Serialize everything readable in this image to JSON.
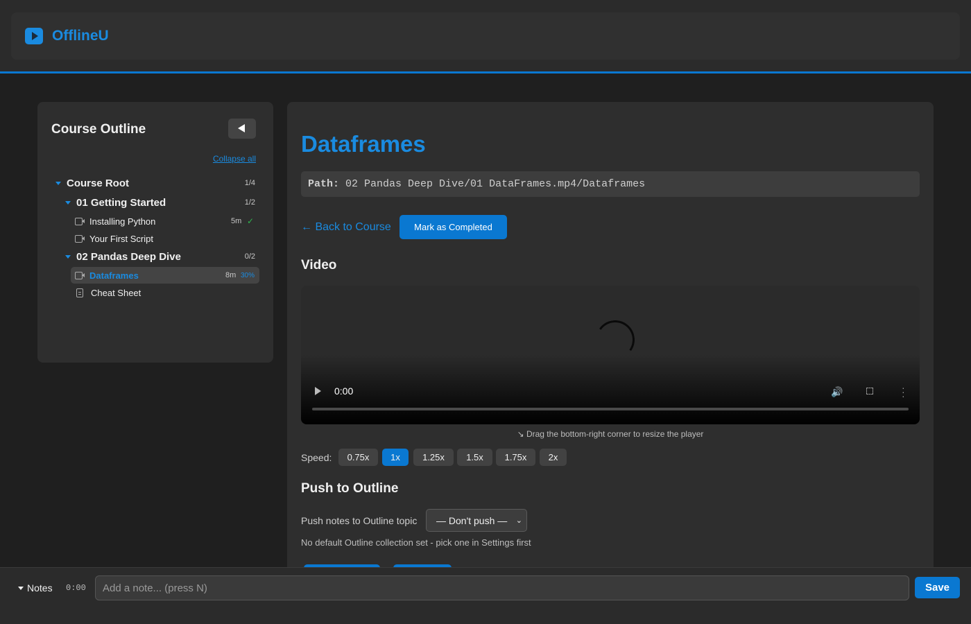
{
  "app": {
    "name": "OfflineU",
    "accent": "#0a78d1",
    "icon": "play-icon"
  },
  "sidebar": {
    "title": "Course Outline",
    "collapse_all": "Collapse all",
    "root": {
      "label": "Course Root",
      "count": "1/4"
    },
    "sections": [
      {
        "label": "01 Getting Started",
        "count": "1/2",
        "items": [
          {
            "label": "Installing Python",
            "duration": "5m",
            "completed": true,
            "type": "video"
          },
          {
            "label": "Your First Script",
            "type": "video"
          }
        ]
      },
      {
        "label": "02 Pandas Deep Dive",
        "count": "0/2",
        "items": [
          {
            "label": "Dataframes",
            "duration": "8m",
            "progress": "30%",
            "active": true,
            "type": "video"
          },
          {
            "label": "Cheat Sheet",
            "type": "document"
          }
        ]
      }
    ]
  },
  "main": {
    "title": "Dataframes",
    "path_label": "Path:",
    "path_value": "02 Pandas Deep Dive/01 DataFrames.mp4/Dataframes",
    "back_label": "← Back to Course",
    "mark_label": "Mark as Completed",
    "video_heading": "Video",
    "video_time": "0:00",
    "resize_hint": "↘ Drag the bottom-right corner to resize the player",
    "speed_label": "Speed:",
    "speeds": [
      "0.75x",
      "1x",
      "1.25x",
      "1.5x",
      "1.75x",
      "2x"
    ],
    "active_speed": "1x",
    "push_heading": "Push to Outline",
    "push_label": "Push notes to Outline topic",
    "push_select": "— Don't push —",
    "push_note": "No default Outline collection set - pick one in Settings first"
  },
  "notes": {
    "toggle": "Notes",
    "time": "0:00",
    "placeholder": "Add a note... (press N)",
    "save": "Save"
  }
}
